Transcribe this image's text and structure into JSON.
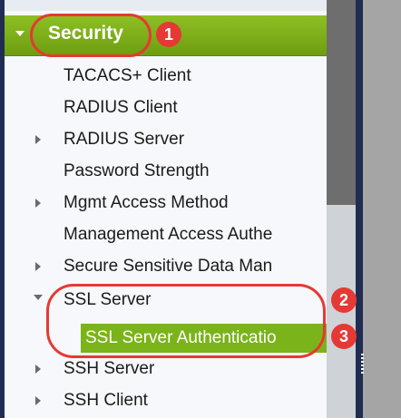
{
  "nav": {
    "security_label": "Security",
    "items": [
      "TACACS+ Client",
      "RADIUS Client",
      "RADIUS Server",
      "Password Strength",
      "Mgmt Access Method",
      "Management Access Authe",
      "Secure Sensitive Data Man",
      "SSL Server",
      "SSL Server Authenticatio",
      "SSH Server",
      "SSH Client"
    ]
  },
  "callouts": [
    "1",
    "2",
    "3"
  ],
  "colors": {
    "accent_green": "#7bb31a",
    "callout_red": "#e53935",
    "nav_background": "#f6f8fb",
    "frame_navy": "#1f2d52"
  },
  "icons": {
    "expanded": "caret-down-icon",
    "collapsed": "caret-right-icon"
  }
}
